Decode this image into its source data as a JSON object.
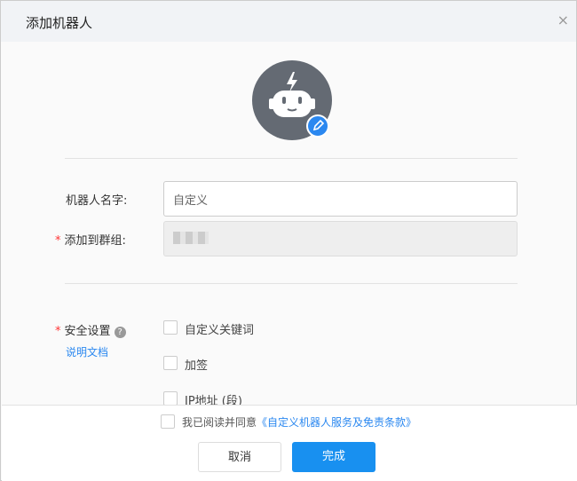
{
  "dialog": {
    "title": "添加机器人",
    "close_icon": "×"
  },
  "form": {
    "name_label": "机器人名字:",
    "name_value": "自定义",
    "group_label": "添加到群组:",
    "group_required": "*",
    "security_label": "安全设置",
    "security_required": "*",
    "help_link": "说明文档",
    "options": [
      "自定义关键词",
      "加签",
      "IP地址 (段)"
    ]
  },
  "footer": {
    "agree_text": "我已阅读并同意",
    "agree_link": "《自定义机器人服务及免责条款》",
    "cancel": "取消",
    "done": "完成"
  },
  "colors": {
    "accent": "#1890f0",
    "required": "#ff3333"
  }
}
